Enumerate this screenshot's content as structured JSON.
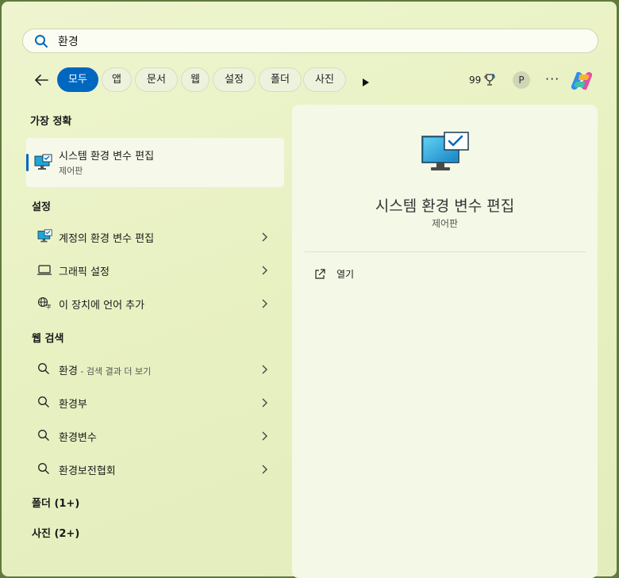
{
  "search": {
    "value": "환경"
  },
  "tabs": [
    "모두",
    "앱",
    "문서",
    "웹",
    "설정",
    "폴더",
    "사진"
  ],
  "points": "99",
  "avatar_letter": "P",
  "more_label": "···",
  "sections": {
    "best": "가장 정확",
    "settings": "설정",
    "web": "웹 검색",
    "folders": "폴더 (1+)",
    "photos": "사진 (2+)"
  },
  "best_match": {
    "title": "시스템 환경 변수 편집",
    "subtitle": "제어판"
  },
  "settings_items": [
    {
      "label": "계정의 환경 변수 편집"
    },
    {
      "label": "그래픽 설정"
    },
    {
      "label": "이 장치에 언어 추가"
    }
  ],
  "web_items": [
    {
      "label": "환경",
      "suffix": " - 검색 결과 더 보기"
    },
    {
      "label": "환경부",
      "suffix": ""
    },
    {
      "label": "환경변수",
      "suffix": ""
    },
    {
      "label": "환경보전협회",
      "suffix": ""
    }
  ],
  "preview": {
    "title": "시스템 환경 변수 편집",
    "subtitle": "제어판",
    "open_label": "열기"
  },
  "colors": {
    "accent": "#0067c0"
  }
}
